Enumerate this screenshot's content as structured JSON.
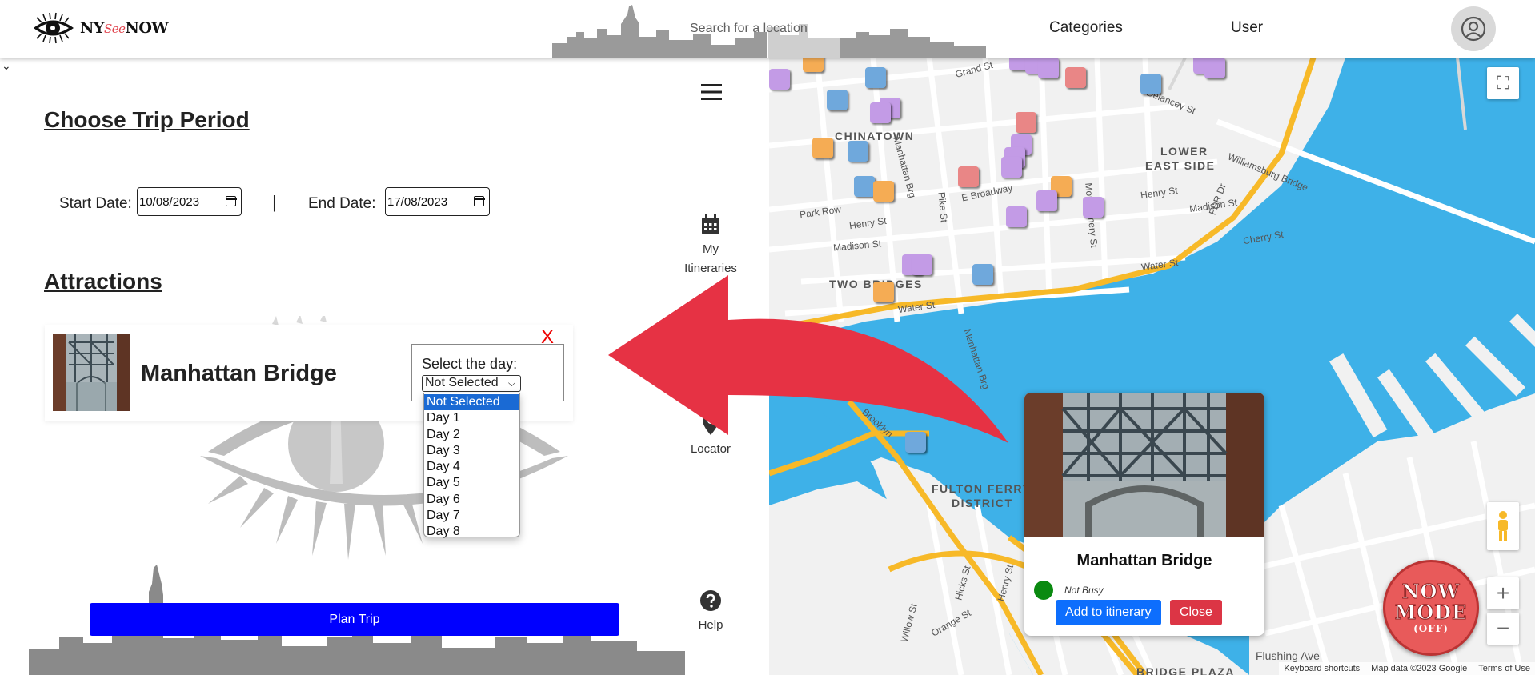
{
  "header": {
    "logo_ny": "NY",
    "logo_see": "See",
    "logo_now": "NOW",
    "search_placeholder": "Search for a location",
    "nav_categories": "Categories",
    "nav_user": "User"
  },
  "trip": {
    "heading": "Choose Trip Period",
    "start_label": "Start Date:",
    "start_value": "10/08/2023",
    "separator": "|",
    "end_label": "End Date:",
    "end_value": "17/08/2023"
  },
  "attractions": {
    "heading": "Attractions",
    "items": [
      {
        "name": "Manhattan Bridge",
        "remove_label": "X",
        "day_prompt": "Select the day:",
        "selected_day": "Not Selected",
        "day_options": [
          "Not Selected",
          "Day 1",
          "Day 2",
          "Day 3",
          "Day 4",
          "Day 5",
          "Day 6",
          "Day 7",
          "Day 8"
        ]
      }
    ]
  },
  "actions": {
    "plan_trip": "Plan Trip"
  },
  "side_menu": {
    "itineraries_line1": "My",
    "itineraries_line2": "Itineraries",
    "locator": "Locator",
    "help": "Help"
  },
  "map": {
    "neighborhoods": {
      "chinatown": "CHINATOWN",
      "lower_east_side_1": "LOWER",
      "lower_east_side_2": "EAST SIDE",
      "two_bridges": "TWO BRIDGES",
      "fulton_1": "FULTON FERRY",
      "fulton_2": "DISTRICT",
      "bridge_plaza": "BRIDGE PLAZA"
    },
    "streets": {
      "grand_st": "Grand St",
      "delancey": "Delancey St",
      "williamsburg_bridge": "Williamsburg Bridge",
      "henry_st": "Henry St",
      "madison_st": "Madison St",
      "cherry_st": "Cherry St",
      "water_st": "Water St",
      "park_row": "Park Row",
      "e_broadway": "E Broadway",
      "pike_st": "Pike St",
      "montgomery_st": "Montgomery St",
      "manhattan_brg": "Manhattan Brg",
      "fdr_dr": "FDR Dr",
      "brooklyn": "Brooklyn",
      "flushing_ave": "Flushing Ave",
      "hicks_st": "Hicks St",
      "orange_st": "Orange St",
      "willow_st": "Willow St",
      "henry_st_bk": "Henry St"
    },
    "info_window": {
      "title": "Manhattan Bridge",
      "status": "Not Busy",
      "add_button": "Add to itinerary",
      "close_button": "Close"
    },
    "now_mode": {
      "line1": "NOW",
      "line2": "MODE",
      "line3": "(OFF)"
    },
    "footer": {
      "shortcuts": "Keyboard shortcuts",
      "map_data": "Map data ©2023 Google",
      "terms": "Terms of Use"
    }
  },
  "colors": {
    "plan_button": "#0000ff",
    "add_button": "#0d6efd",
    "close_button": "#dc3545",
    "busy_indicator": "#0a8a10",
    "arrow": "#e63244",
    "water": "#3eb1e8",
    "highway": "#f7b928"
  },
  "icons": {
    "menu": "hamburger-icon",
    "itineraries": "calendar-icon",
    "locator": "location-pin-icon",
    "help": "question-circle-icon",
    "user": "user-circle-icon"
  }
}
